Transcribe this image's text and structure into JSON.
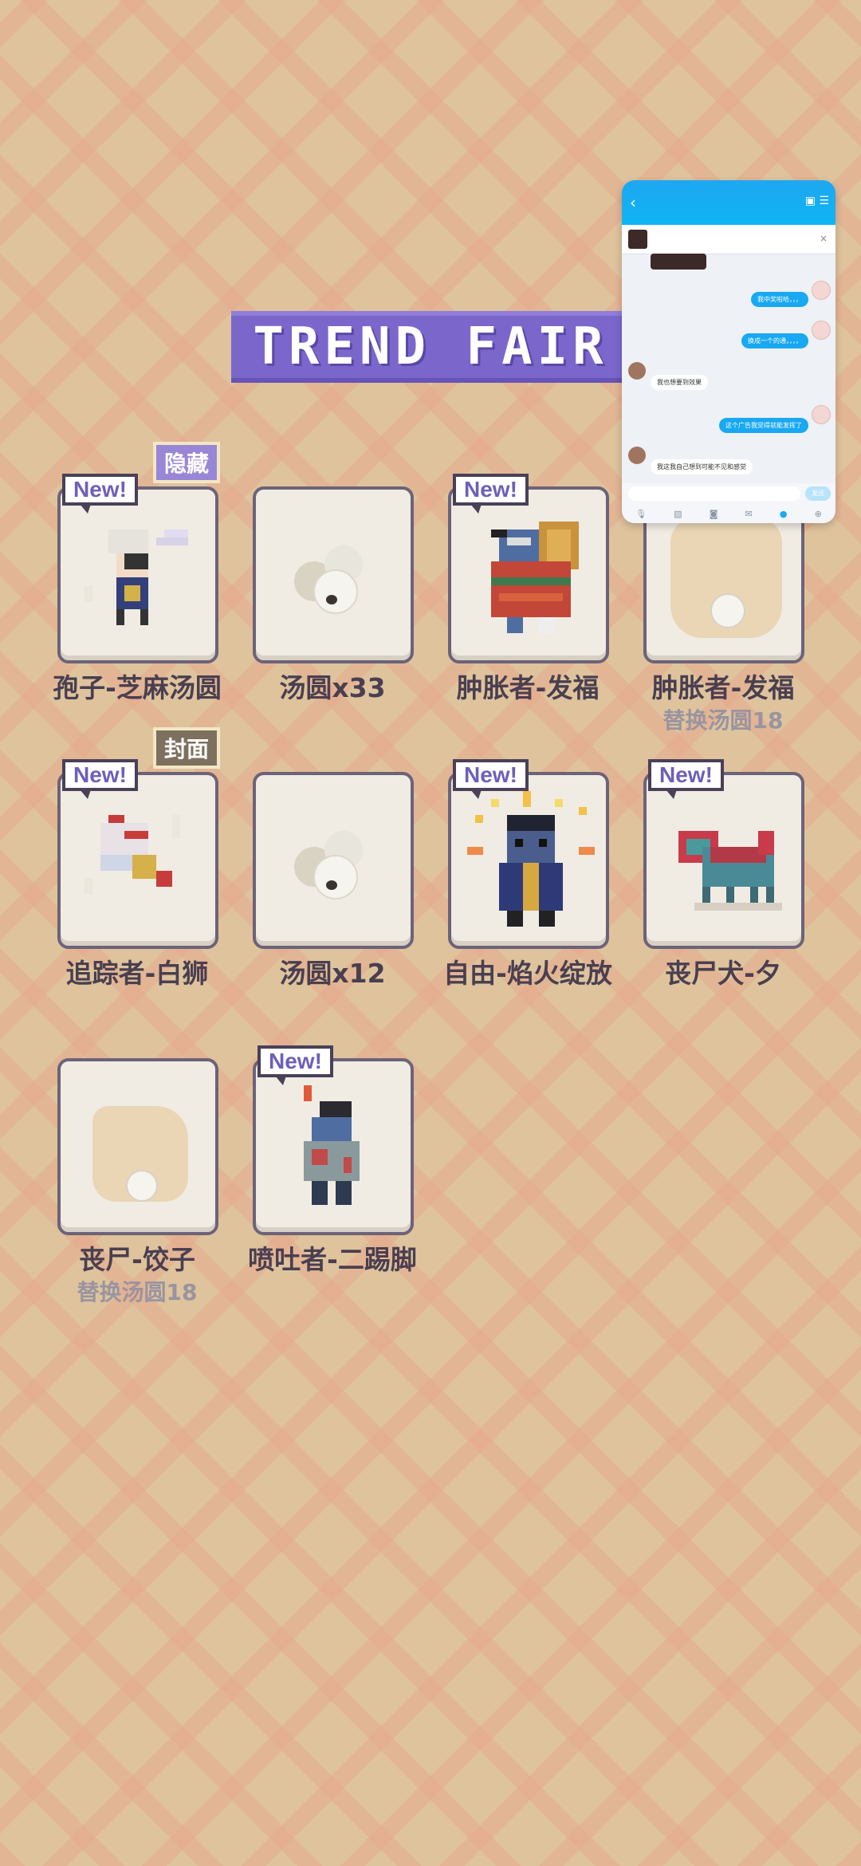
{
  "banner": {
    "title": "TREND FAIR"
  },
  "items": [
    {
      "name": "孢子-芝麻汤圆",
      "new": "New!",
      "badge": "隐藏",
      "sub": ""
    },
    {
      "name": "汤圆x33",
      "new": "",
      "badge": "",
      "sub": ""
    },
    {
      "name": "肿胀者-发福",
      "new": "New!",
      "badge": "",
      "sub": ""
    },
    {
      "name": "肿胀者-发福",
      "new": "",
      "badge": "",
      "sub": "替换汤圆18"
    },
    {
      "name": "追踪者-白狮",
      "new": "New!",
      "badge": "封面",
      "sub": ""
    },
    {
      "name": "汤圆x12",
      "new": "",
      "badge": "",
      "sub": ""
    },
    {
      "name": "自由-焰火绽放",
      "new": "New!",
      "badge": "",
      "sub": ""
    },
    {
      "name": "丧尸犬-夕",
      "new": "New!",
      "badge": "",
      "sub": ""
    },
    {
      "name": "丧尸-饺子",
      "new": "",
      "badge": "",
      "sub": "替换汤圆18"
    },
    {
      "name": "喷吐者-二踢脚",
      "new": "New!",
      "badge": "",
      "sub": ""
    }
  ],
  "chat": {
    "back_icon": "chevron-left-icon",
    "tool_icons": [
      "mic-icon",
      "image-icon",
      "camera-icon",
      "envelope-icon",
      "emoji-icon",
      "plus-icon"
    ],
    "send_label": "发送",
    "messages": [
      {
        "dir": "out",
        "text": "我中奖啦哈，，，"
      },
      {
        "dir": "out",
        "text": "换成一个的通，，，，"
      },
      {
        "dir": "in",
        "text": "我也想要到效果"
      },
      {
        "dir": "out",
        "text": "这个广告我觉得就能发挥了"
      },
      {
        "dir": "in",
        "text": "我这我自己想到可能不见和感觉"
      }
    ]
  }
}
